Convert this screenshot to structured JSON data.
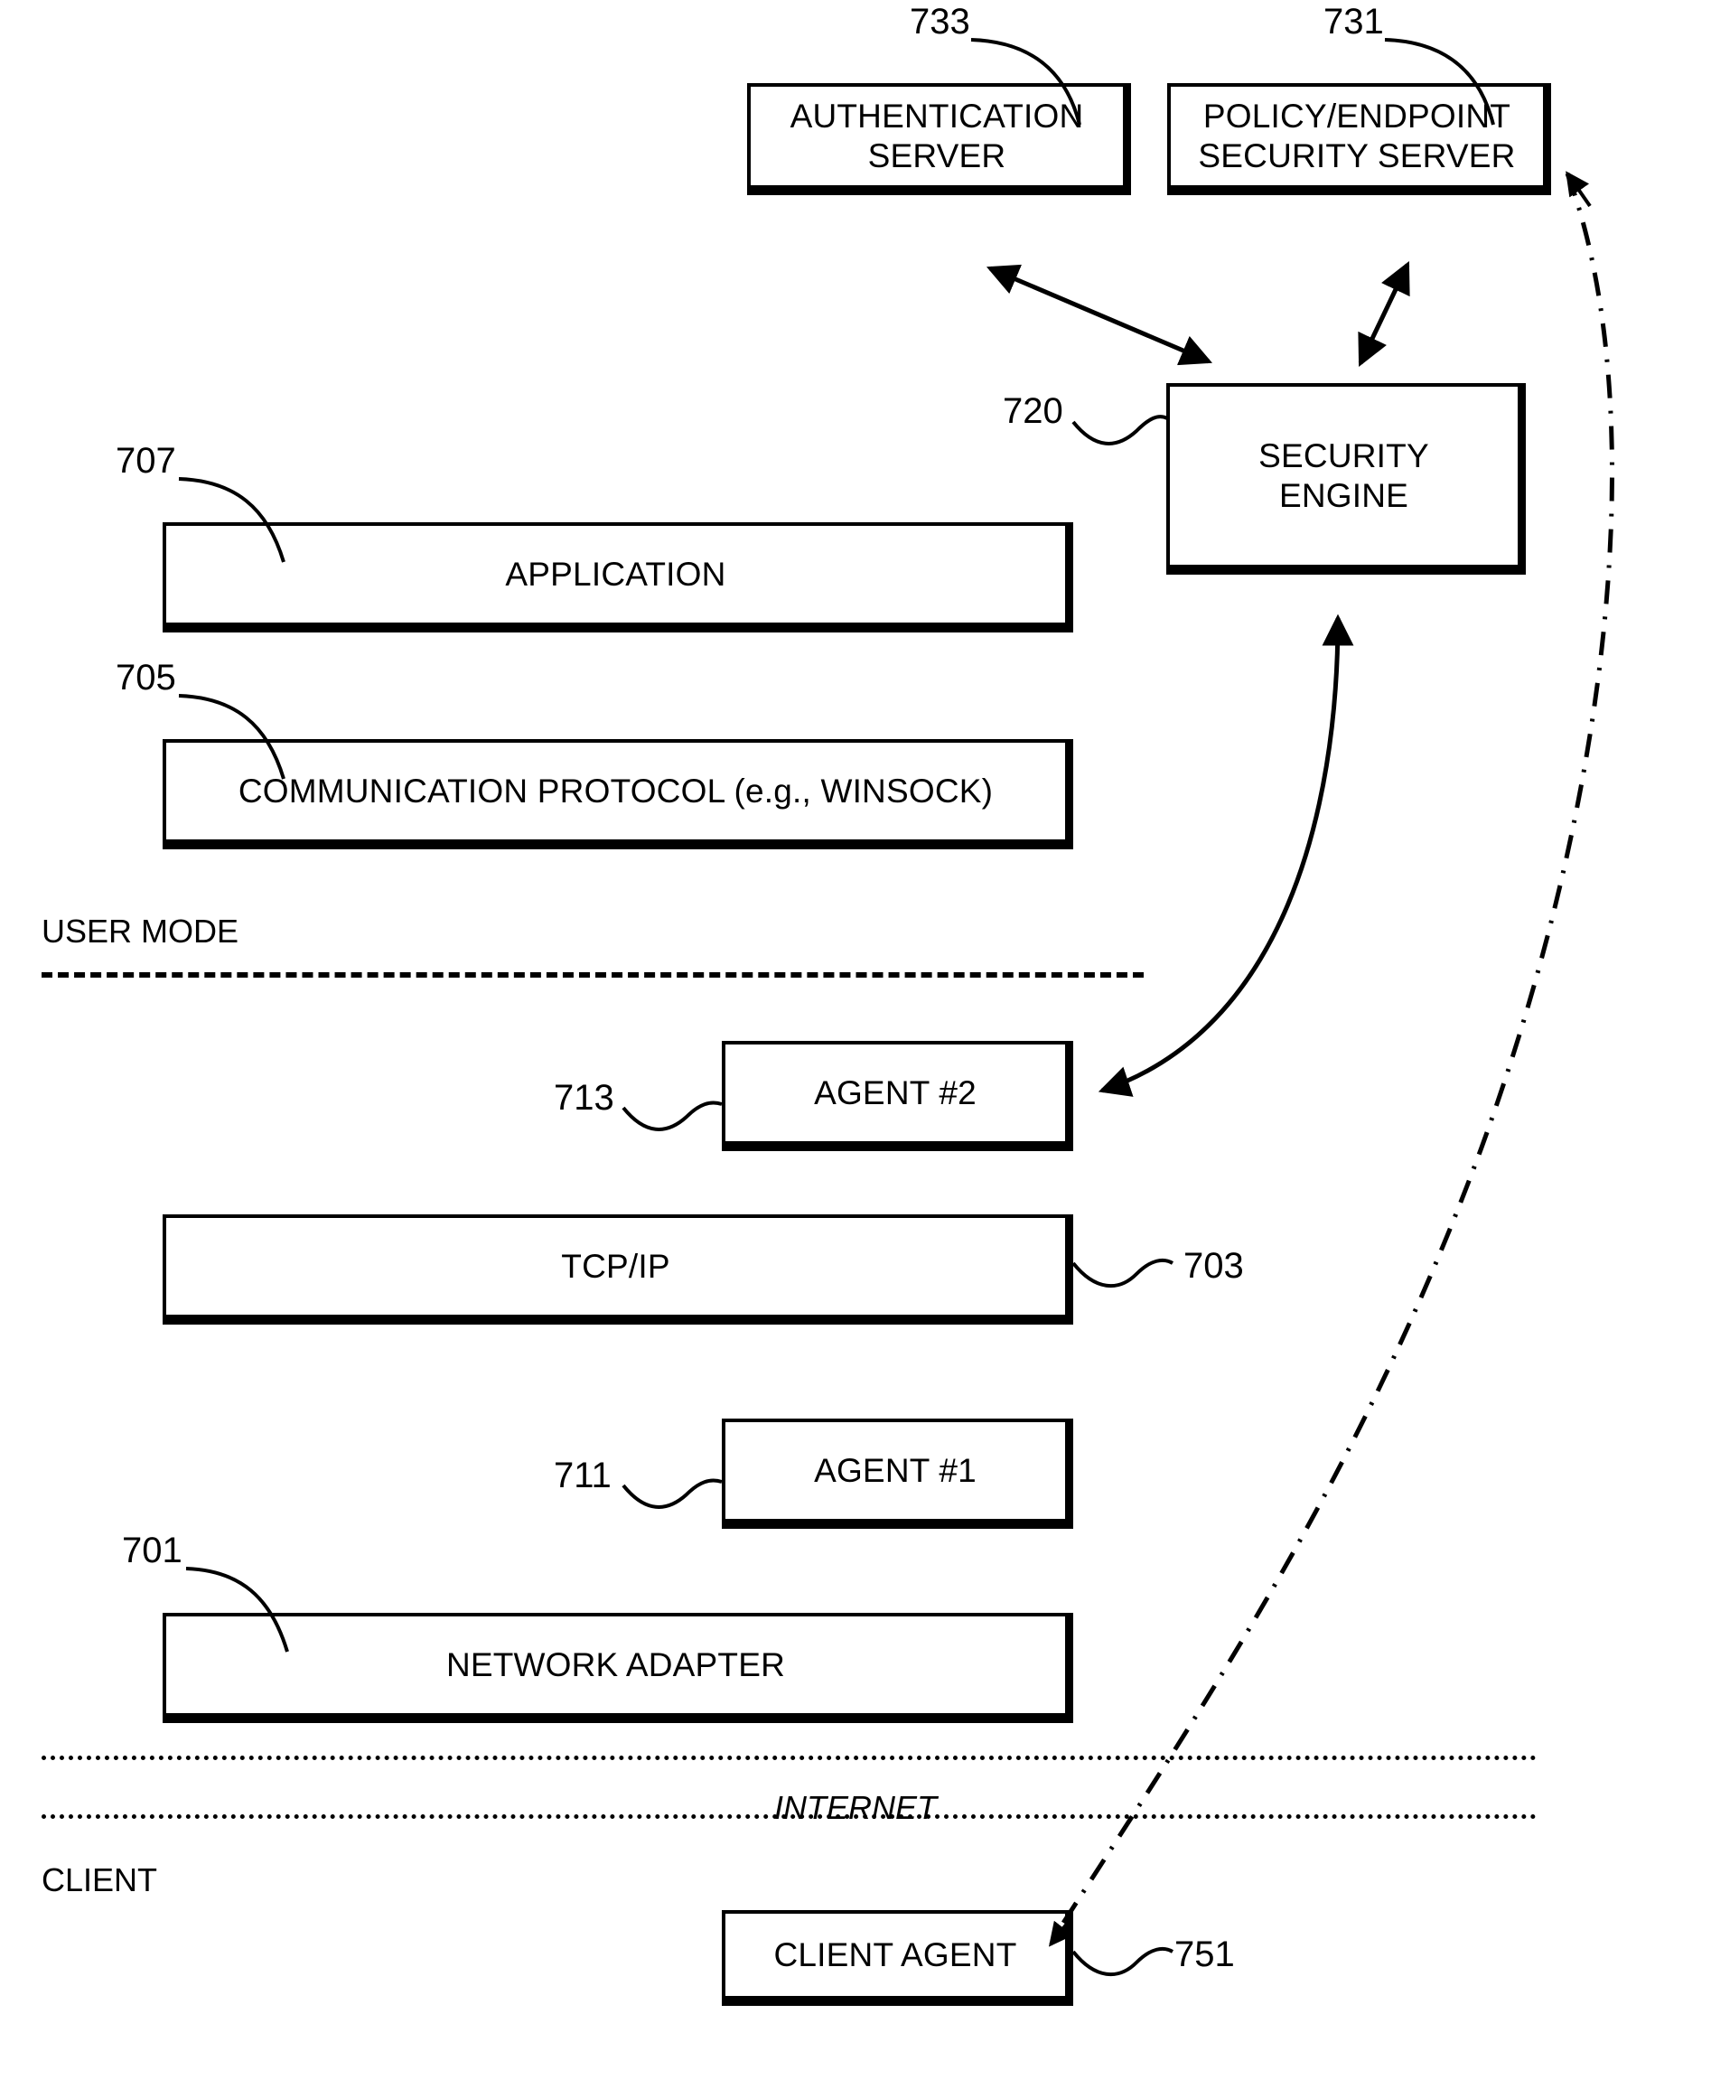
{
  "figure": {
    "nodes": [
      {
        "id": "auth",
        "label": "AUTHENTICATION\nSERVER",
        "ref": "733"
      },
      {
        "id": "policy",
        "label": "POLICY/ENDPOINT\nSECURITY SERVER",
        "ref": "731"
      },
      {
        "id": "security",
        "label": "SECURITY\nENGINE",
        "ref": "720"
      },
      {
        "id": "app",
        "label": "APPLICATION",
        "ref": "707"
      },
      {
        "id": "comm",
        "label": "COMMUNICATION PROTOCOL (e.g., WINSOCK)",
        "ref": "705"
      },
      {
        "id": "agent2",
        "label": "AGENT #2",
        "ref": "713"
      },
      {
        "id": "tcpip",
        "label": "TCP/IP",
        "ref": "703"
      },
      {
        "id": "agent1",
        "label": "AGENT #1",
        "ref": "711"
      },
      {
        "id": "netadp",
        "label": "NETWORK ADAPTER",
        "ref": "701"
      },
      {
        "id": "clientag",
        "label": "CLIENT AGENT",
        "ref": "751"
      }
    ],
    "refs": {
      "auth": "733",
      "policy": "731",
      "security": "720",
      "application": "707",
      "communication_protocol": "705",
      "agent2": "713",
      "tcpip": "703",
      "agent1": "711",
      "network_adapter": "701",
      "client_agent": "751"
    },
    "regions": {
      "user_mode": "USER MODE",
      "internet": "INTERNET",
      "client": "CLIENT"
    },
    "connectors": [
      {
        "from": "auth",
        "to": "security",
        "style": "solid",
        "arrows": "both"
      },
      {
        "from": "policy",
        "to": "security",
        "style": "solid",
        "arrows": "both"
      },
      {
        "from": "security",
        "to": "agent2",
        "style": "solid",
        "arrows": "both"
      },
      {
        "from": "policy",
        "to": "clientag",
        "style": "dash-dot",
        "arrows": "both"
      }
    ],
    "colors": {
      "background": "#ffffff",
      "stroke": "#000000",
      "text": "#000000"
    }
  }
}
